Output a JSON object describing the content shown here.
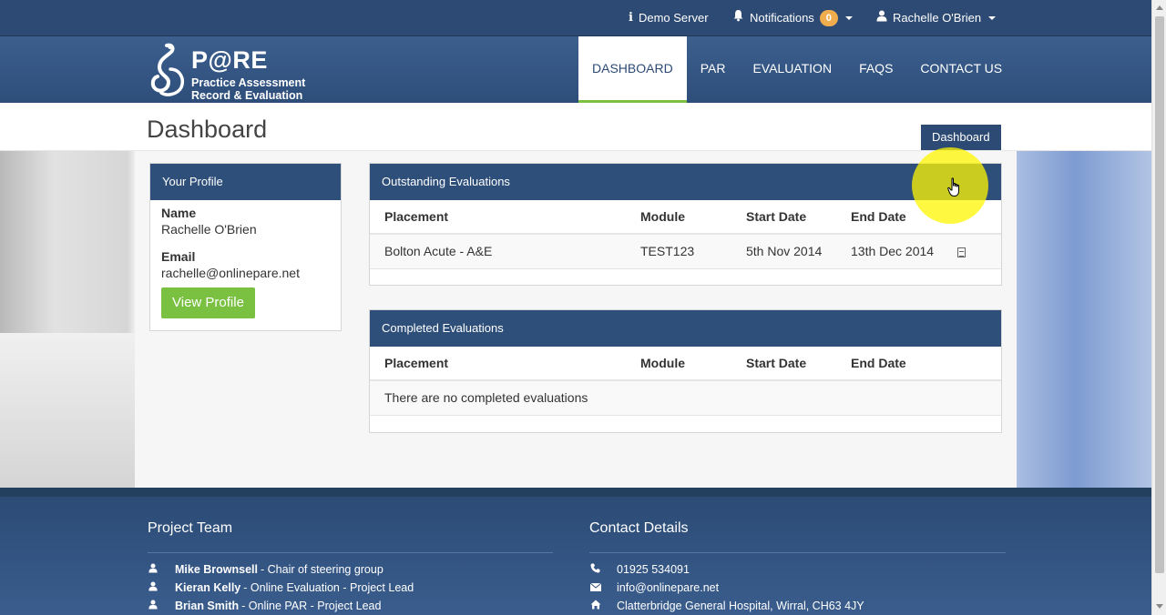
{
  "topbar": {
    "server_label": "Demo Server",
    "notifications_label": "Notifications",
    "notifications_count": "0",
    "user_name": "Rachelle O'Brien"
  },
  "logo": {
    "brand": "P@RE",
    "tagline_line1": "Practice Assessment",
    "tagline_line2": "Record & Evaluation"
  },
  "nav": {
    "items": [
      "DASHBOARD",
      "PAR",
      "EVALUATION",
      "FAQS",
      "CONTACT US"
    ],
    "active": "DASHBOARD"
  },
  "page": {
    "title": "Dashboard",
    "breadcrumb": "Dashboard"
  },
  "profile": {
    "heading": "Your Profile",
    "name_label": "Name",
    "name_value": "Rachelle O'Brien",
    "email_label": "Email",
    "email_value": "rachelle@onlinepare.net",
    "button_label": "View Profile"
  },
  "outstanding": {
    "heading": "Outstanding Evaluations",
    "columns": [
      "Placement",
      "Module",
      "Start Date",
      "End Date"
    ],
    "rows": [
      [
        "Bolton Acute - A&E",
        "TEST123",
        "5th Nov 2014",
        "13th Dec 2014"
      ]
    ]
  },
  "completed": {
    "heading": "Completed Evaluations",
    "columns": [
      "Placement",
      "Module",
      "Start Date",
      "End Date"
    ],
    "empty_message": "There are no completed evaluations"
  },
  "footer": {
    "team_title": "Project Team",
    "team": [
      {
        "name": "Mike Brownsell",
        "role": " - Chair of steering group"
      },
      {
        "name": "Kieran Kelly",
        "role": " - Online Evaluation - Project Lead"
      },
      {
        "name": "Brian Smith",
        "role": " - Online PAR - Project Lead"
      }
    ],
    "contact_title": "Contact Details",
    "phone": "01925 534091",
    "email": "info@onlinepare.net",
    "address": "Clatterbridge General Hospital, Wirral, CH63 4JY"
  },
  "icons": {
    "info": "info-icon",
    "bell": "bell-icon",
    "user": "user-icon",
    "document": "document-icon",
    "phone": "phone-icon",
    "envelope": "envelope-icon",
    "home": "home-icon"
  },
  "colors": {
    "primary": "#2c4a73",
    "accent_green": "#7ac142",
    "badge": "#f0ad4e"
  }
}
